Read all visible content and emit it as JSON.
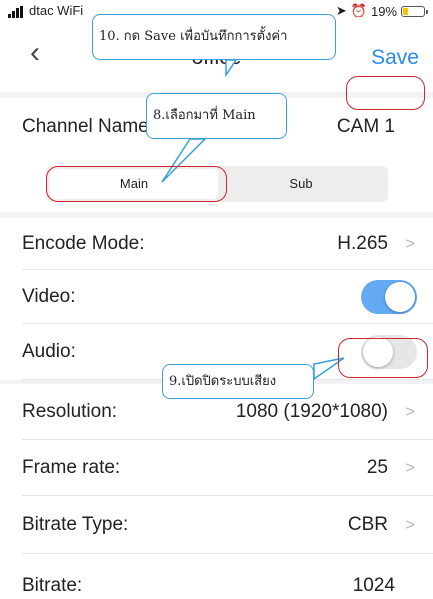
{
  "status_bar": {
    "carrier": "dtac WiFi",
    "battery": "19%"
  },
  "nav": {
    "back_icon": "‹",
    "title": "office",
    "save_label": "Save"
  },
  "channel": {
    "label": "Channel Name",
    "value": "CAM 1"
  },
  "stream_tabs": [
    {
      "label": "Main",
      "selected": true
    },
    {
      "label": "Sub",
      "selected": false
    }
  ],
  "settings": {
    "encode_mode": {
      "label": "Encode Mode:",
      "value": "H.265"
    },
    "video": {
      "label": "Video:",
      "enabled": true
    },
    "audio": {
      "label": "Audio:",
      "enabled": false
    },
    "resolution": {
      "label": "Resolution:",
      "value": "1080 (1920*1080)"
    },
    "frame_rate": {
      "label": "Frame rate:",
      "value": "25"
    },
    "bitrate_type": {
      "label": "Bitrate Type:",
      "value": "CBR"
    },
    "bitrate": {
      "label": "Bitrate:",
      "value": "1024"
    }
  },
  "annotations": {
    "save_note": "10. กด Save เพื่อบันทึกการตั้งค่า",
    "main_note": "8.เลือกมาที่ Main",
    "audio_note": "9.เปิดปิดระบบเสียง"
  },
  "colors": {
    "accent": "#2c8ae8",
    "annotation_red": "#d0242a",
    "callout_border": "#3aa0d8"
  }
}
